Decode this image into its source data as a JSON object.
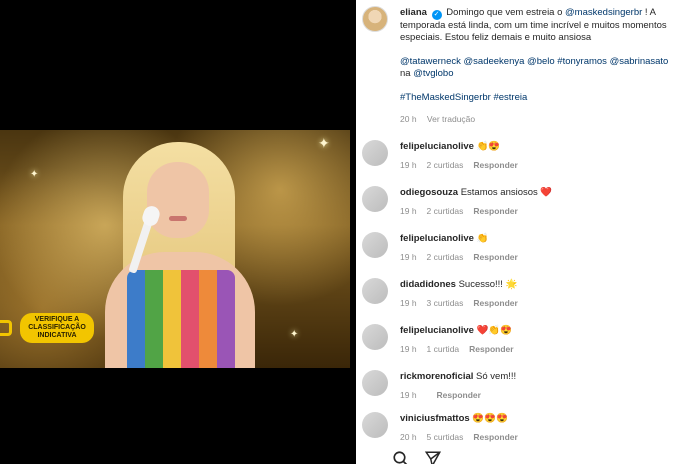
{
  "post": {
    "username": "eliana",
    "mention_1": "@maskedsingerbr",
    "caption_line_1": "Domingo que vem estreia o",
    "caption_line_1_end": "! A temporada está linda, com um time incrível e muitos momentos especiais. Estou feliz demais e muito ansiosa",
    "tags_line": [
      "@tatawerneck",
      "@sadeekenya",
      "@belo",
      "#tonyramos",
      "@sabrinasato"
    ],
    "tags_line_2_prefix": "na",
    "tags_line_2_tag": "@tvglobo",
    "hashtags": [
      "#TheMaskedSingerbr",
      "#estreia"
    ],
    "time": "20 h",
    "translate": "Ver tradução"
  },
  "video": {
    "rating_text": "VERIFIQUE A CLASSIFICAÇÃO INDICATIVA"
  },
  "comments": [
    {
      "user": "felipelucianolive",
      "text": "👏😍",
      "time": "19 h",
      "likes": "2 curtidas",
      "reply": "Responder"
    },
    {
      "user": "odiegosouza",
      "text": "Estamos ansiosos ❤️",
      "time": "19 h",
      "likes": "2 curtidas",
      "reply": "Responder"
    },
    {
      "user": "felipelucianolive",
      "text": "👏",
      "time": "19 h",
      "likes": "2 curtidas",
      "reply": "Responder"
    },
    {
      "user": "didadidones",
      "text": "Sucesso!!! 🌟",
      "time": "19 h",
      "likes": "3 curtidas",
      "reply": "Responder"
    },
    {
      "user": "felipelucianolive",
      "text": "❤️👏😍",
      "time": "19 h",
      "likes": "1 curtida",
      "reply": "Responder"
    },
    {
      "user": "rickmorenoficial",
      "text": "Só vem!!!",
      "time": "19 h",
      "likes": "",
      "reply": "Responder"
    },
    {
      "user": "viniciusfmattos",
      "text": "😍😍😍",
      "time": "20 h",
      "likes": "5 curtidas",
      "reply": "Responder"
    }
  ],
  "colors": {
    "link": "#00376b",
    "verified": "#0095f6",
    "meta": "#8e8e8e",
    "rating": "#f2c500"
  }
}
